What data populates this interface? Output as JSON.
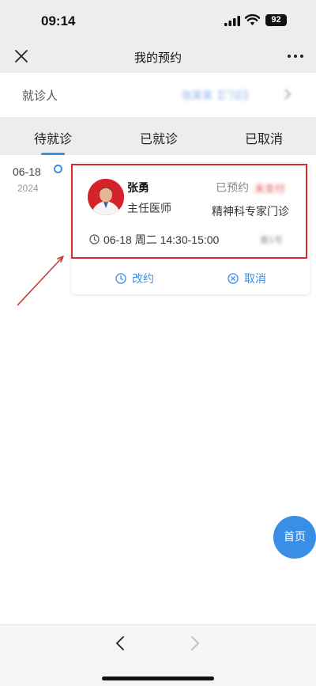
{
  "status_bar": {
    "time": "09:14",
    "battery": "92"
  },
  "nav": {
    "title": "我的预约",
    "close_icon": "close-icon",
    "more_icon": "more-icon"
  },
  "patient": {
    "label": "就诊人",
    "value": "张某某【门诊】"
  },
  "tabs": [
    {
      "label": "待就诊",
      "active": true
    },
    {
      "label": "已就诊",
      "active": false
    },
    {
      "label": "已取消",
      "active": false
    }
  ],
  "appointments": [
    {
      "date": "06-18",
      "year": "2024",
      "doctor_name": "张勇",
      "doctor_title": "主任医师",
      "status": "已预约",
      "status_extra": "未支付",
      "department": "精神科专家门诊",
      "time": "06-18 周二 14:30-15:00",
      "time_extra": "第1号",
      "actions": {
        "reschedule": "改约",
        "cancel": "取消"
      }
    }
  ],
  "home_button": "首页",
  "colors": {
    "accent": "#3a8ee6",
    "highlight": "#d62e2e",
    "background": "#ededed"
  }
}
